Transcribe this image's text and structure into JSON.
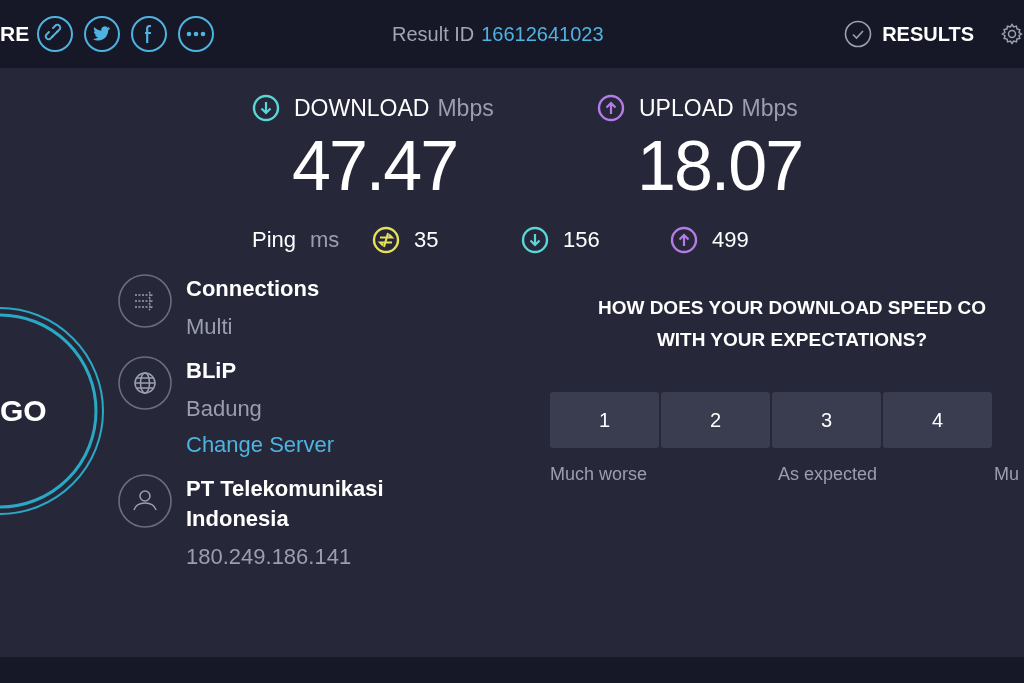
{
  "top_bar": {
    "share_label": "RE",
    "share_buttons": [
      {
        "kind": "link"
      },
      {
        "kind": "twitter"
      },
      {
        "kind": "facebook"
      },
      {
        "kind": "more"
      }
    ],
    "result_label": "Result ID",
    "result_id": "16612641023",
    "results_button": "RESULTS"
  },
  "go_button": {
    "label": "GO"
  },
  "speeds": [
    {
      "kind": "download",
      "label": "DOWNLOAD",
      "unit": "Mbps",
      "value": "47.47",
      "color": "#5ad6d6"
    },
    {
      "kind": "upload",
      "label": "UPLOAD",
      "unit": "Mbps",
      "value": "18.07",
      "color": "#b57ce8"
    }
  ],
  "ping": {
    "label": "Ping",
    "unit": "ms",
    "readings": [
      {
        "kind": "ping",
        "value": "35",
        "color": "#e8e05a"
      },
      {
        "kind": "download",
        "value": "156",
        "color": "#5ad6d6"
      },
      {
        "kind": "upload",
        "value": "499",
        "color": "#b57ce8"
      }
    ]
  },
  "server_info": [
    {
      "kind": "connections",
      "title": "Connections",
      "detail": "Multi"
    },
    {
      "kind": "server",
      "title": "BLiP",
      "detail": "Badung",
      "link": "Change Server"
    },
    {
      "kind": "provider",
      "title": "PT Telekomunikasi Indonesia",
      "detail": "180.249.186.141"
    }
  ],
  "rating": {
    "question_lines": [
      "HOW DOES YOUR DOWNLOAD SPEED CO",
      "WITH YOUR EXPECTATIONS?"
    ],
    "options": [
      "1",
      "2",
      "3",
      "4"
    ],
    "scale_labels": [
      "Much worse",
      "As expected",
      "Mu"
    ]
  }
}
